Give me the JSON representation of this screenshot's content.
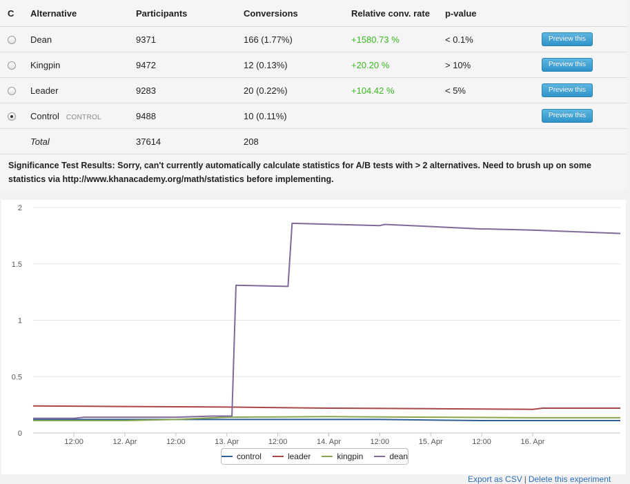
{
  "table": {
    "headers": [
      "C",
      "Alternative",
      "Participants",
      "Conversions",
      "Relative conv. rate",
      "p-value"
    ],
    "rows": [
      {
        "name": "Dean",
        "badge": "",
        "participants": "9371",
        "conversions": "166 (1.77%)",
        "relative": "+1580.73 %",
        "pvalue": "< 0.1%",
        "button": "Preview this",
        "selected": false
      },
      {
        "name": "Kingpin",
        "badge": "",
        "participants": "9472",
        "conversions": "12 (0.13%)",
        "relative": "+20.20 %",
        "pvalue": "> 10%",
        "button": "Preview this",
        "selected": false
      },
      {
        "name": "Leader",
        "badge": "",
        "participants": "9283",
        "conversions": "20 (0.22%)",
        "relative": "+104.42 %",
        "pvalue": "< 5%",
        "button": "Preview this",
        "selected": false
      },
      {
        "name": "Control",
        "badge": "CONTROL",
        "participants": "9488",
        "conversions": "10 (0.11%)",
        "relative": "",
        "pvalue": "",
        "button": "Preview this",
        "selected": true
      }
    ],
    "total": {
      "label": "Total",
      "participants": "37614",
      "conversions": "208"
    }
  },
  "significance": "Significance Test Results: Sorry, can't currently automatically calculate statistics for A/B tests with > 2 alternatives. Need to brush up on some statistics via http://www.khanacademy.org/math/statistics before implementing.",
  "chart_data": {
    "type": "line",
    "ylim": [
      0,
      2
    ],
    "y_ticks": [
      "0",
      "0.5",
      "1",
      "1.5",
      "2"
    ],
    "x_ticks": [
      "12:00",
      "12. Apr",
      "12:00",
      "13. Apr",
      "12:00",
      "14. Apr",
      "12:00",
      "15. Apr",
      "12:00",
      "16. Apr"
    ],
    "x_tick_values": [
      0.5,
      1.0,
      1.5,
      2.0,
      2.5,
      3.0,
      3.5,
      4.0,
      4.5,
      5.0
    ],
    "xlim": [
      0.1,
      5.86
    ],
    "grid": true,
    "legend_position": "bottom-center",
    "series": [
      {
        "name": "control",
        "color": "#2f5f98",
        "points": [
          [
            0.1,
            0.12
          ],
          [
            1.5,
            0.12
          ],
          [
            2.5,
            0.12
          ],
          [
            3.5,
            0.12
          ],
          [
            4.5,
            0.11
          ],
          [
            5.86,
            0.11
          ]
        ]
      },
      {
        "name": "leader",
        "color": "#aa4643",
        "points": [
          [
            0.1,
            0.24
          ],
          [
            1.0,
            0.235
          ],
          [
            2.0,
            0.23
          ],
          [
            3.0,
            0.22
          ],
          [
            4.0,
            0.215
          ],
          [
            5.0,
            0.21
          ],
          [
            5.1,
            0.22
          ],
          [
            5.86,
            0.22
          ]
        ]
      },
      {
        "name": "kingpin",
        "color": "#89a54e",
        "points": [
          [
            0.1,
            0.11
          ],
          [
            1.0,
            0.11
          ],
          [
            1.5,
            0.12
          ],
          [
            2.0,
            0.14
          ],
          [
            3.0,
            0.145
          ],
          [
            4.0,
            0.14
          ],
          [
            5.0,
            0.135
          ],
          [
            5.86,
            0.135
          ]
        ]
      },
      {
        "name": "dean",
        "color": "#80699b",
        "points": [
          [
            0.1,
            0.13
          ],
          [
            0.5,
            0.13
          ],
          [
            0.6,
            0.14
          ],
          [
            1.5,
            0.14
          ],
          [
            1.86,
            0.15
          ],
          [
            2.05,
            0.15
          ],
          [
            2.09,
            1.31
          ],
          [
            2.6,
            1.3
          ],
          [
            2.64,
            1.86
          ],
          [
            3.5,
            1.84
          ],
          [
            3.55,
            1.85
          ],
          [
            4.5,
            1.81
          ],
          [
            4.56,
            1.81
          ],
          [
            5.0,
            1.8
          ],
          [
            5.86,
            1.77
          ]
        ]
      }
    ]
  },
  "footer": {
    "export": "Export as CSV",
    "separator": "|",
    "delete": "Delete this experiment"
  }
}
